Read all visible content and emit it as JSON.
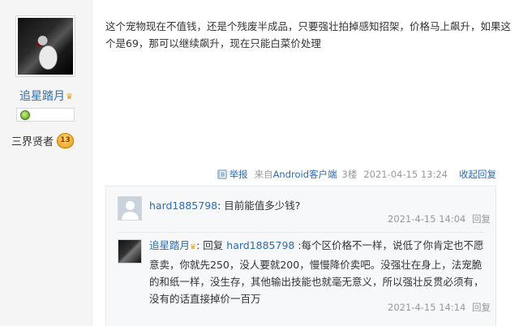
{
  "user": {
    "name": "追星踏月",
    "crown_icon": "crown-icon",
    "rank_label": "三界贤者",
    "rank_level": "13"
  },
  "post": {
    "text": "这个宠物现在不值钱，还是个残废半成品，只要强壮拍掉感知招架，价格马上飙升，如果这个是69，那可以继续飙升，现在只能白菜价处理",
    "report": "举报",
    "from_prefix": "来自",
    "from_client": "Android客户端",
    "floor": "3楼",
    "time": "2021-04-15 13:24",
    "collapse_reply": "收起回复"
  },
  "replies": [
    {
      "user": "hard1885798",
      "text": ": 目前能值多少钱?",
      "time": "2021-4-15 14:04",
      "reply_label": "回复"
    },
    {
      "user": "追星踏月",
      "reply_prefix": ": 回复 ",
      "reply_to": "hard1885798",
      "text": " :每个区价格不一样，说低了你肯定也不愿意卖，你就先250，没人要就200，慢慢降价卖吧。没强壮在身上，法宠脆的和纸一样，没生存，其他输出技能也就毫无意义，所以强壮反贯必须有，没有的话直接掉价一百万",
      "time": "2021-4-15 14:14",
      "reply_label": "回复"
    }
  ],
  "colors": {
    "link": "#2b6cb3",
    "meta": "#999999",
    "badge": "#e69a10"
  }
}
